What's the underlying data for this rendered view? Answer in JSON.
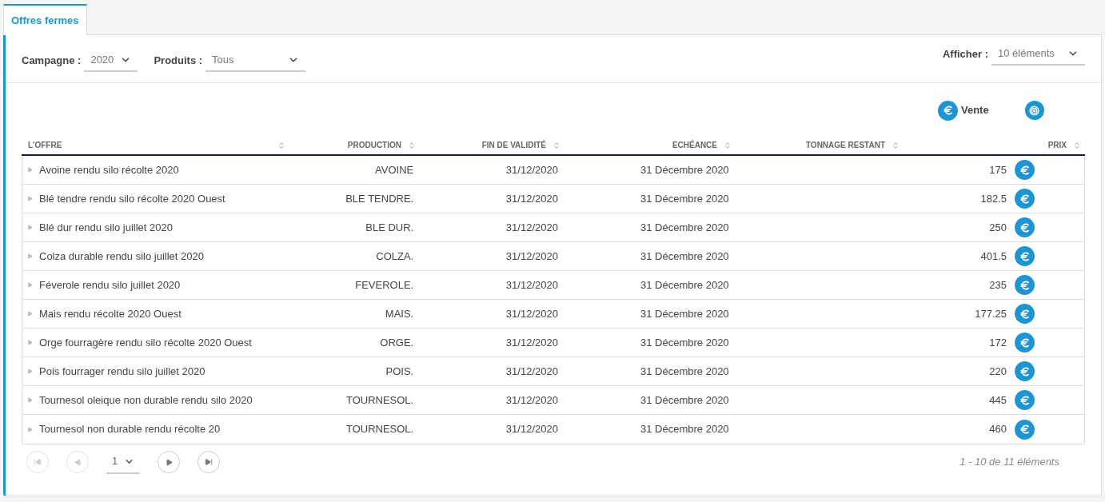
{
  "tabs": [
    {
      "label": "Offres fermes",
      "selected": true
    }
  ],
  "filters": [
    {
      "label": "Campagne :",
      "value": "2020"
    },
    {
      "label": "Produits :",
      "value": "Tous"
    }
  ],
  "page_size": {
    "label": "Afficher :",
    "value": "10 éléments"
  },
  "legend": {
    "label": "Vente"
  },
  "table": {
    "columns": [
      "L'OFFRE",
      "PRODUCTION",
      "FIN DE VALIDITÉ",
      "ECHÉANCE",
      "TONNAGE RESTANT",
      "PRIX"
    ],
    "rows": [
      {
        "offer": "Avoine rendu silo récolte 2020",
        "production": "AVOINE",
        "validity": "31/12/2020",
        "due": "31 Décembre 2020",
        "price": "175"
      },
      {
        "offer": "Blé tendre rendu silo récolte 2020 Ouest",
        "production": "BLE TENDRE.",
        "validity": "31/12/2020",
        "due": "31 Décembre 2020",
        "price": "182.5"
      },
      {
        "offer": "Blé dur rendu silo juillet 2020",
        "production": "BLE DUR.",
        "validity": "31/12/2020",
        "due": "31 Décembre 2020",
        "price": "250"
      },
      {
        "offer": "Colza durable rendu silo juillet 2020",
        "production": "COLZA.",
        "validity": "31/12/2020",
        "due": "31 Décembre 2020",
        "price": "401.5"
      },
      {
        "offer": "Féverole rendu silo juillet 2020",
        "production": "FEVEROLE.",
        "validity": "31/12/2020",
        "due": "31 Décembre 2020",
        "price": "235"
      },
      {
        "offer": "Mais rendu récolte 2020 Ouest",
        "production": "MAIS.",
        "validity": "31/12/2020",
        "due": "31 Décembre 2020",
        "price": "177.25"
      },
      {
        "offer": "Orge fourragère rendu silo récolte 2020 Ouest",
        "production": "ORGE.",
        "validity": "31/12/2020",
        "due": "31 Décembre 2020",
        "price": "172"
      },
      {
        "offer": "Pois fourrager rendu silo juillet 2020",
        "production": "POIS.",
        "validity": "31/12/2020",
        "due": "31 Décembre 2020",
        "price": "220"
      },
      {
        "offer": "Tournesol oleique non durable rendu silo 2020",
        "production": "TOURNESOL.",
        "validity": "31/12/2020",
        "due": "31 Décembre 2020",
        "price": "445"
      },
      {
        "offer": "Tournesol non durable rendu récolte 20",
        "production": "TOURNESOL.",
        "validity": "31/12/2020",
        "due": "31 Décembre 2020",
        "price": "460"
      }
    ]
  },
  "pagination": {
    "page": "1",
    "summary": "1 - 10 de 11 éléments"
  }
}
